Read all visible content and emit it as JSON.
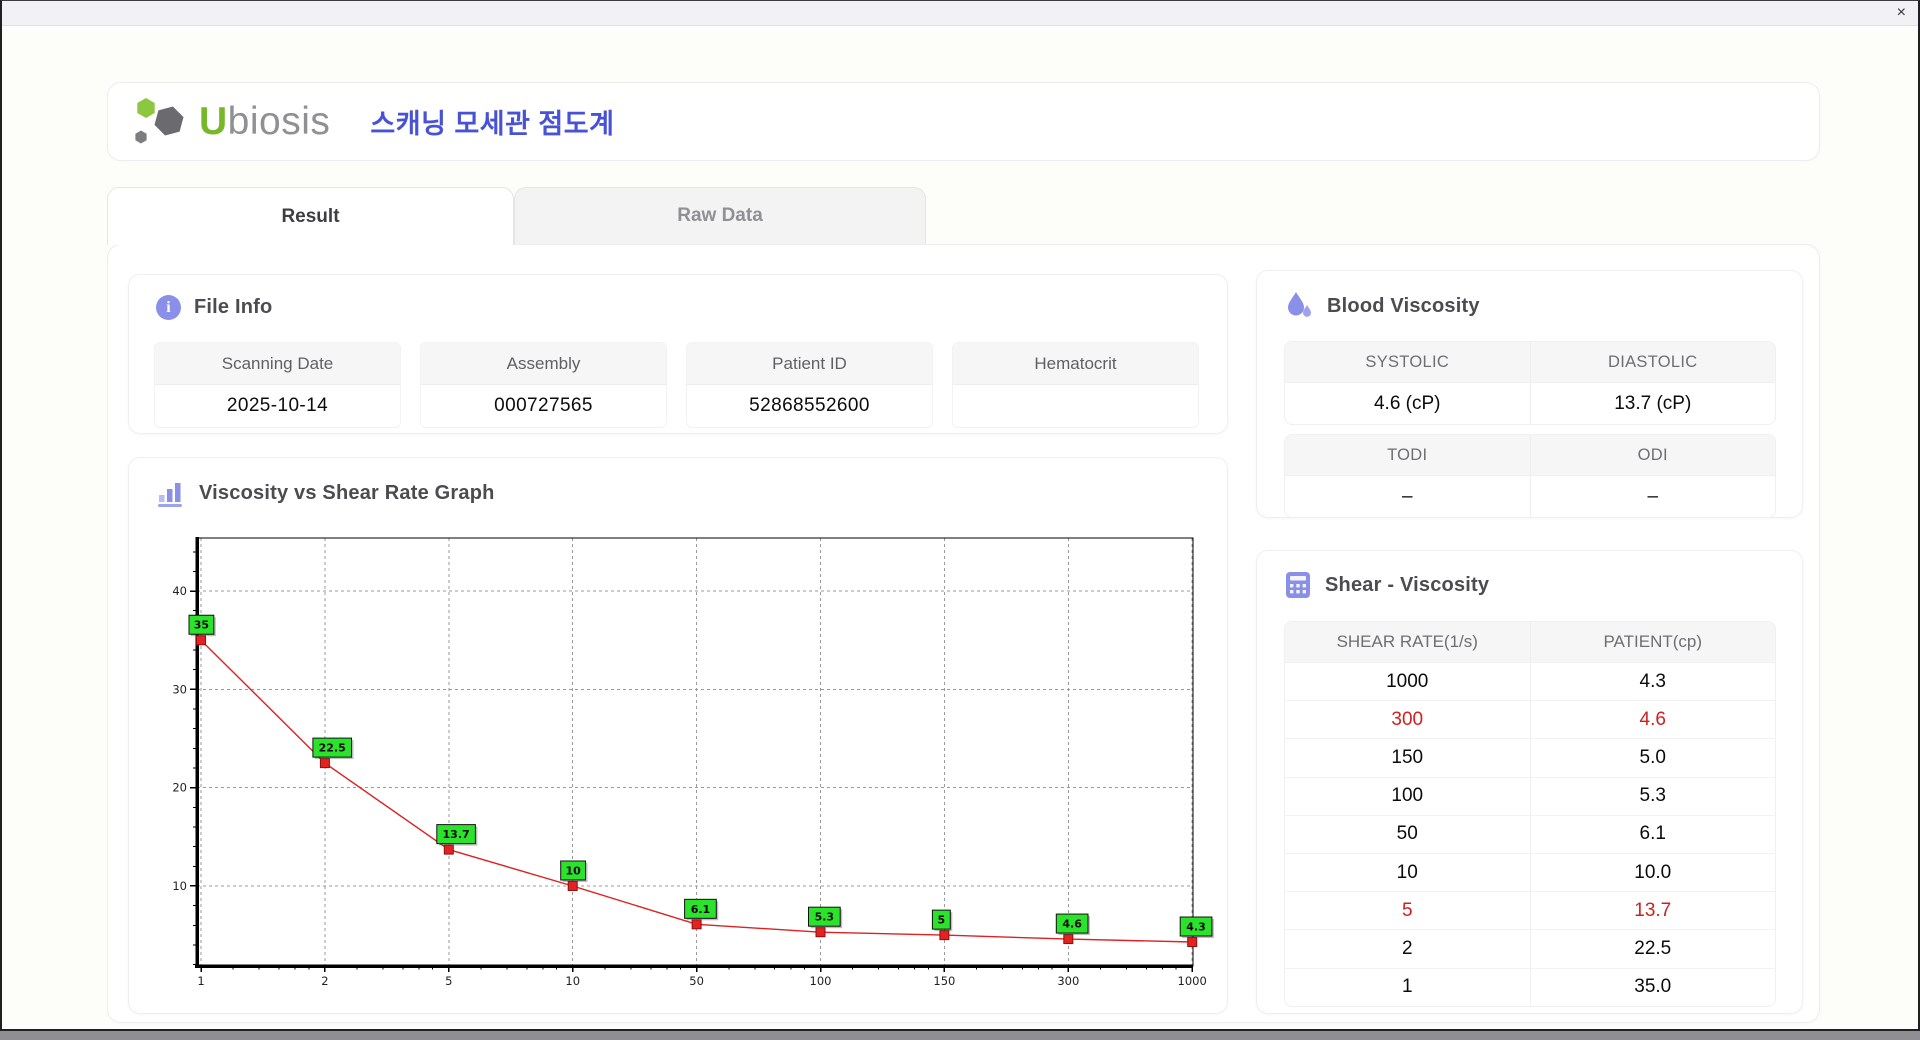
{
  "window": {
    "close_label": "×"
  },
  "header": {
    "brand_u": "U",
    "brand_rest": "biosis",
    "korean_title": "스캐닝 모세관 점도계"
  },
  "tabs": [
    {
      "label": "Result",
      "active": true
    },
    {
      "label": "Raw Data",
      "active": false
    }
  ],
  "file_info": {
    "title": "File Info",
    "fields": [
      {
        "label": "Scanning Date",
        "value": "2025-10-14"
      },
      {
        "label": "Assembly",
        "value": "000727565"
      },
      {
        "label": "Patient ID",
        "value": "52868552600"
      },
      {
        "label": "Hematocrit",
        "value": ""
      }
    ]
  },
  "blood_viscosity": {
    "title": "Blood Viscosity",
    "groups": [
      {
        "headers": [
          "SYSTOLIC",
          "DIASTOLIC"
        ],
        "values": [
          "4.6 (cP)",
          "13.7 (cP)"
        ]
      },
      {
        "headers": [
          "TODI",
          "ODI"
        ],
        "values": [
          "–",
          "–"
        ]
      }
    ]
  },
  "graph": {
    "title": "Viscosity vs Shear Rate Graph"
  },
  "chart_data": {
    "type": "line",
    "title": "Viscosity vs Shear Rate Graph",
    "x": [
      1,
      2,
      5,
      10,
      50,
      100,
      150,
      300,
      1000
    ],
    "x_tick_labels": [
      "1",
      "2",
      "5",
      "10",
      "50",
      "100",
      "150",
      "300",
      "1000"
    ],
    "series": [
      {
        "name": "PATIENT",
        "values": [
          35.0,
          22.5,
          13.7,
          10.0,
          6.1,
          5.3,
          5.0,
          4.6,
          4.3
        ]
      }
    ],
    "point_labels": [
      "35",
      "22.5",
      "13.7",
      "10",
      "6.1",
      "5.3",
      "5",
      "4.6",
      "4.3"
    ],
    "y_ticks": [
      10,
      20,
      30,
      40
    ],
    "ylim": [
      1.86,
      45.4
    ],
    "xlabel": "",
    "ylabel": "",
    "grid": true,
    "legend": false,
    "line_color": "#dd2222",
    "marker_color": "#e32222",
    "point_label_bg": "#2be32b"
  },
  "shear_viscosity": {
    "title": "Shear - Viscosity",
    "columns": [
      "SHEAR RATE(1/s)",
      "PATIENT(cp)"
    ],
    "highlight_color": "#d01f1f",
    "rows": [
      {
        "shear": "1000",
        "patient": "4.3",
        "highlight": false
      },
      {
        "shear": "300",
        "patient": "4.6",
        "highlight": true
      },
      {
        "shear": "150",
        "patient": "5.0",
        "highlight": false
      },
      {
        "shear": "100",
        "patient": "5.3",
        "highlight": false
      },
      {
        "shear": "50",
        "patient": "6.1",
        "highlight": false
      },
      {
        "shear": "10",
        "patient": "10.0",
        "highlight": false
      },
      {
        "shear": "5",
        "patient": "13.7",
        "highlight": true
      },
      {
        "shear": "2",
        "patient": "22.5",
        "highlight": false
      },
      {
        "shear": "1",
        "patient": "35.0",
        "highlight": false
      }
    ]
  }
}
